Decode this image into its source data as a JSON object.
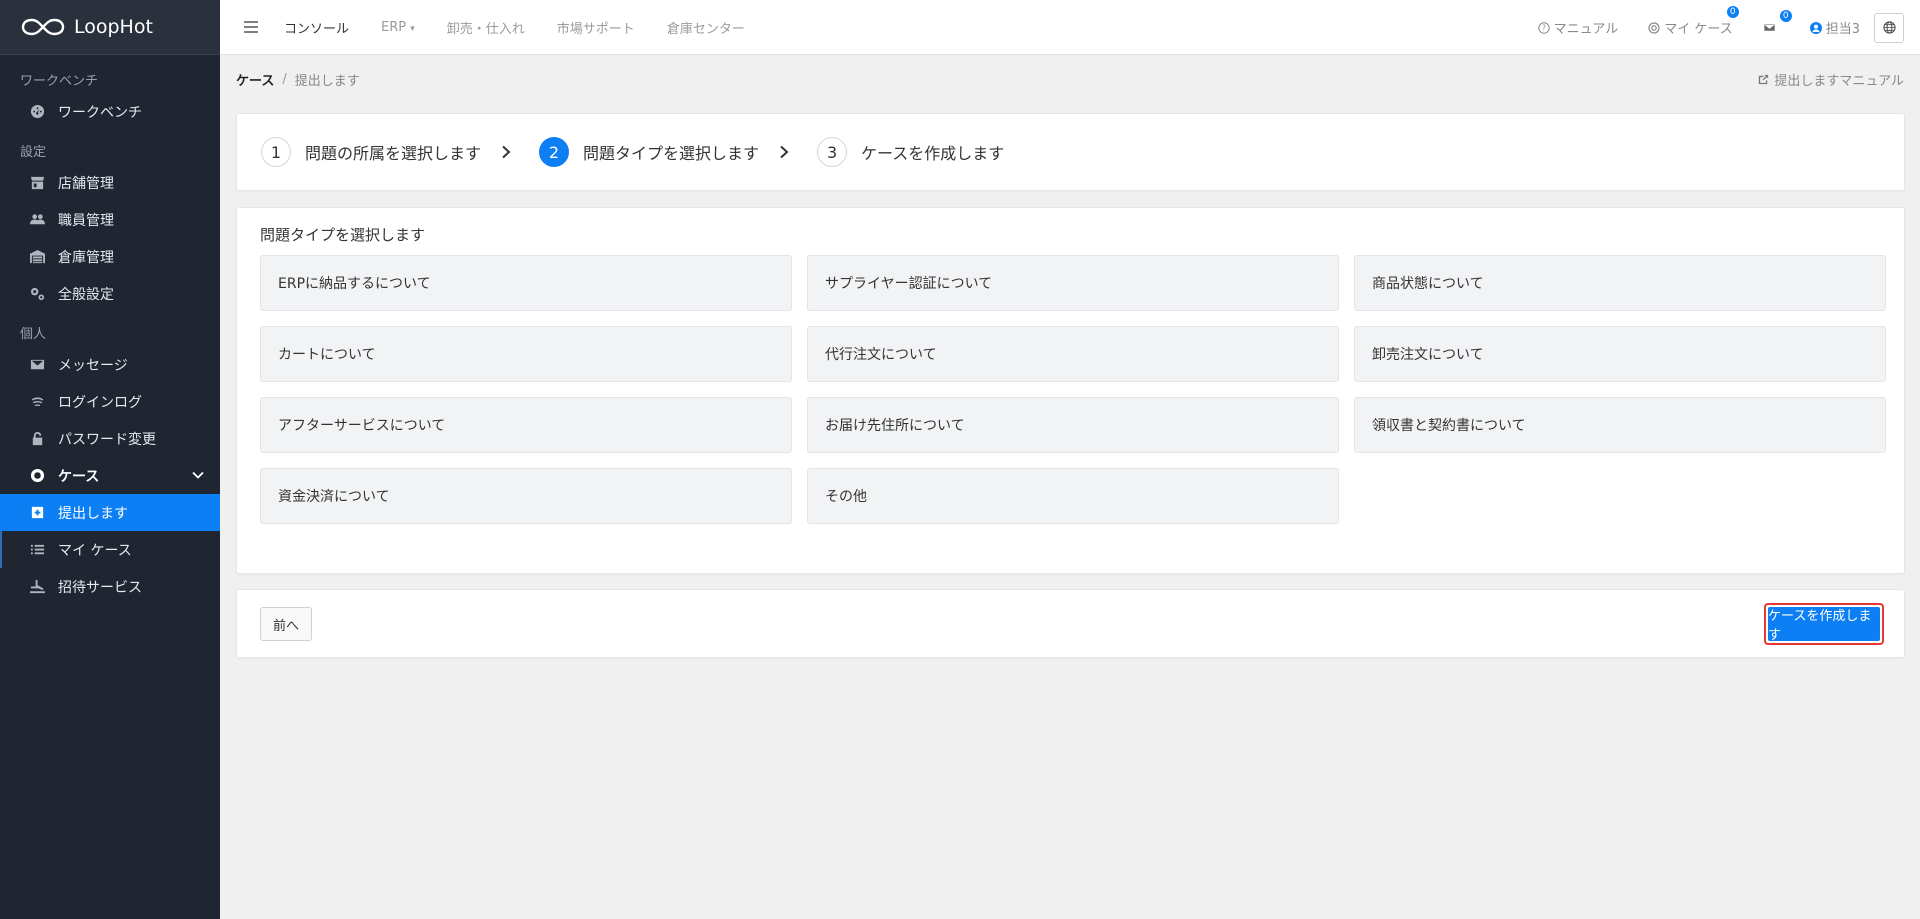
{
  "brand": {
    "name": "LoopHot"
  },
  "sidebar": {
    "sections": [
      {
        "title": "ワークベンチ"
      },
      {
        "title": "設定"
      },
      {
        "title": "個人"
      }
    ],
    "items": [
      {
        "label": "ワークベンチ",
        "icon": "dashboard-icon"
      },
      {
        "label": "店舗管理",
        "icon": "store-icon"
      },
      {
        "label": "職員管理",
        "icon": "users-icon"
      },
      {
        "label": "倉庫管理",
        "icon": "warehouse-icon"
      },
      {
        "label": "全般設定",
        "icon": "gears-icon"
      },
      {
        "label": "メッセージ",
        "icon": "envelope-icon"
      },
      {
        "label": "ログインログ",
        "icon": "fingerprint-icon"
      },
      {
        "label": "パスワード変更",
        "icon": "lock-icon"
      },
      {
        "label": "ケース",
        "icon": "lifebuoy-icon"
      },
      {
        "label": "提出します",
        "icon": "plus-square-icon"
      },
      {
        "label": "マイ ケース",
        "icon": "list-icon"
      },
      {
        "label": "招待サービス",
        "icon": "hand-icon"
      }
    ]
  },
  "topbar": {
    "nav": [
      "コンソール",
      "ERP",
      "卸売・仕入れ",
      "市場サポート",
      "倉庫センター"
    ],
    "manual": "マニュアル",
    "my_cases": "マイ ケース",
    "my_cases_count": "0",
    "messages_count": "0",
    "user": "担当3"
  },
  "breadcrumb": {
    "root": "ケース",
    "sep": "/",
    "current": "提出します",
    "manual_link": "提出しますマニュアル"
  },
  "steps": [
    {
      "num": "1",
      "label": "問題の所属を選択します",
      "active": false
    },
    {
      "num": "2",
      "label": "問題タイプを選択します",
      "active": true
    },
    {
      "num": "3",
      "label": "ケースを作成します",
      "active": false
    }
  ],
  "types": {
    "title": "問題タイプを選択します",
    "options": [
      "ERPに納品するについて",
      "サプライヤー認証について",
      "商品状態について",
      "カートについて",
      "代行注文について",
      "卸売注文について",
      "アフターサービスについて",
      "お届け先住所について",
      "領収書と契約書について",
      "資金決済について",
      "その他"
    ]
  },
  "actions": {
    "prev": "前へ",
    "create": "ケースを作成します"
  },
  "colors": {
    "accent": "#0d7ff5",
    "sidebar_bg": "#1f2631",
    "highlight": "#e53935"
  }
}
